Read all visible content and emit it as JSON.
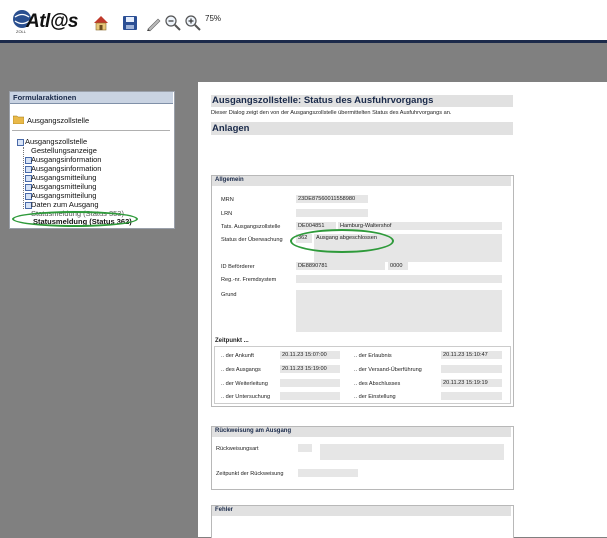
{
  "header": {
    "logo_text": "Atl@s",
    "logo_sub": "ZOLL",
    "zoom_level": "75%",
    "toolbar_icons": [
      "home-icon",
      "save-icon",
      "edit-icon",
      "zoom-out-icon",
      "zoom-in-icon"
    ]
  },
  "left_panel": {
    "title": "Formularaktionen",
    "folder_label": "Ausgangszollstelle",
    "tree": {
      "root": "Ausgangszollstelle",
      "items": [
        "Gestellungsanzeige",
        "Ausgangsinformation",
        "Ausgangsinformation",
        "Ausgangsmitteilung",
        "Ausgangsmitteilung",
        "Ausgangsmitteilung",
        "Daten zum Ausgang",
        "Statusmeldung (Status 353)",
        "Statusmeldung (Status 362)"
      ]
    }
  },
  "main": {
    "title": "Ausgangszollstelle: Status des Ausfuhrvorgangs",
    "description": "Dieser Dialog zeigt den von der Ausgangszollstelle übermittelten Status des Ausfuhrvorgangs an.",
    "anlagen": "Anlagen",
    "allgemein": {
      "heading": "Allgemein",
      "mrn_label": "MRN",
      "mrn_value": "23DE87560011558980",
      "lrn_label": "LRN",
      "lrn_value": "",
      "tats_label": "Tats. Ausgangszollstelle",
      "tats_code": "DE004851",
      "tats_name": "Hamburg-Waltershof",
      "status_label": "Status der Überwachung",
      "status_code": "362",
      "status_text": "Ausgang abgeschlossen",
      "befoerderer_label": "ID Beförderer",
      "befoerderer_value": "DE8890781",
      "befoerderer_suffix": "0000",
      "regnr_label": "Reg.-nr. Fremdsystem",
      "grund_label": "Grund",
      "zeitpunkt_heading": "Zeitpunkt ...",
      "ankunft_label": ".. der Ankunft",
      "ankunft_value": "20.11.23 15:07:00",
      "erlaubnis_label": ".. der Erlaubnis",
      "erlaubnis_value": "20.11.23 15:10:47",
      "ausgangs_label": ".. des Ausgangs",
      "ausgangs_value": "20.11.23 15:19:00",
      "versand_label": ".. der Versand-Überführung",
      "weiterleitung_label": ".. der Weiterleitung",
      "abschlusses_label": ".. des Abschlusses",
      "abschlusses_value": "20.11.23 15:19:19",
      "untersuchung_label": ".. der Untersuchung",
      "einstellung_label": ".. der Einstellung"
    },
    "rueckweisung": {
      "heading": "Rückweisung am Ausgang",
      "art_label": "Rückweisungsart",
      "zeitpunkt_label": "Zeitpunkt der Rückweisung"
    },
    "fehler": {
      "heading": "Fehler"
    }
  },
  "colors": {
    "highlight": "#2e9a3a",
    "header_bar": "#1c2a4a",
    "section_title": "#e1e1e1"
  }
}
